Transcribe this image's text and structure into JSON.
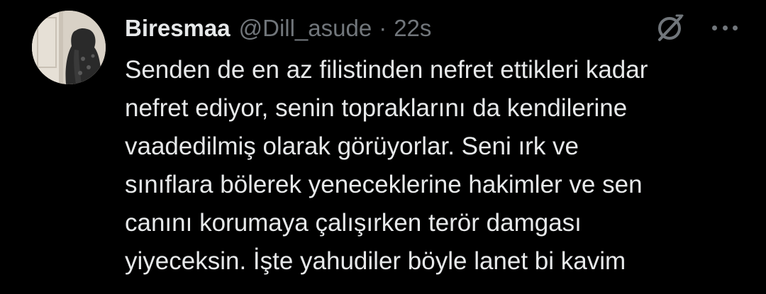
{
  "author": {
    "display_name": "Biresmaa",
    "handle": "@Dill_asude",
    "separator": "·",
    "time": "22s"
  },
  "actions": {
    "grok_icon": "grok-slash-circle-icon",
    "more_icon": "more-dots-icon"
  },
  "tweet": {
    "lines": [
      "Senden de en az filistinden nefret ettikleri kadar",
      "nefret ediyor, senin topraklarını da kendilerine",
      "vaadedilmiş olarak görüyorlar. Seni ırk ve",
      "sınıflara bölerek yeneceklerine hakimler ve sen",
      "canını korumaya çalışırken terör damgası",
      "yiyeceksin. İşte yahudiler böyle lanet bi kavim"
    ]
  },
  "colors": {
    "background": "#000000",
    "primary_text": "#e7e9ea",
    "secondary_text": "#71767b"
  }
}
